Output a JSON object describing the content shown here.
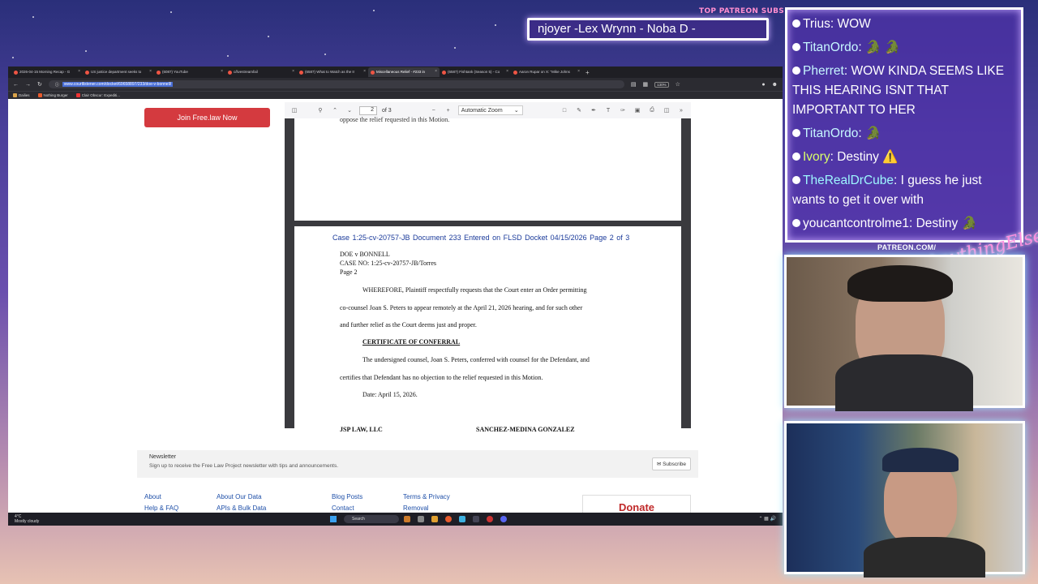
{
  "overlay": {
    "patreon_subs_label": "TOP PATREON SUBS",
    "ticker_text": "njoyer -Lex Wrynn -  Noba D -",
    "patreon_url": "PATREON.COM/",
    "brand_script": "AnythingElse?"
  },
  "browser": {
    "tabs": [
      {
        "label": "2026-04-15 Morning Recap - G",
        "active": false
      },
      {
        "label": "US justice department seeks to",
        "active": false
      },
      {
        "label": "(6087) YouTube",
        "active": false
      },
      {
        "label": "c/livestreamfail",
        "active": false
      },
      {
        "label": "(6587) What to Watch as the Ir",
        "active": false
      },
      {
        "label": "Miscellaneous Relief - #233 in",
        "active": true
      },
      {
        "label": "(6587) Fishtank (Season 5) - Co",
        "active": false
      },
      {
        "label": "Aaron Rupar on X: \"Mike Johns",
        "active": false
      }
    ],
    "new_tab": "+",
    "url": "www.courtlistener.com/docket/69658897/233/doe-v-bonnell/",
    "zoom_badge": "130%",
    "bookmarks": [
      "Dailies",
      "Nothing Burger",
      "Clair Obscur: Expediti..."
    ]
  },
  "page": {
    "join_button": "Join Free.law Now",
    "pdf": {
      "page_number": "2",
      "page_total": "of 3",
      "zoom": "Automatic Zoom",
      "page1_cut_text": "oppose the relief requested in this Motion.",
      "header": "Case 1:25-cv-20757-JB   Document 233   Entered on FLSD Docket 04/15/2026   Page 2 of 3",
      "caption_lines": [
        "DOE v BONNELL",
        "CASE NO: 1:25-cv-20757-JB/Torres",
        "Page 2"
      ],
      "body_lines": [
        "WHEREFORE, Plaintiff respectfully requests that the Court enter an Order permitting",
        "co-counsel Joan S. Peters to appear remotely at the April 21, 2026 hearing, and for such other",
        "and further relief as the Court deems just and proper."
      ],
      "conferral_heading": "CERTIFICATE OF CONFERRAL",
      "conferral_lines": [
        "The undersigned counsel, Joan S. Peters, conferred with counsel for the Defendant, and",
        "certifies that Defendant has no objection to the relief requested in this Motion."
      ],
      "date_line": "Date: April 15, 2026.",
      "sig_left": "JSP LAW, LLC",
      "sig_right": "SANCHEZ-MEDINA GONZALEZ"
    },
    "newsletter": {
      "title": "Newsletter",
      "description": "Sign up to receive the Free Law Project newsletter with tips and announcements.",
      "subscribe": "Subscribe"
    },
    "footer": {
      "about": "About",
      "help": "Help & FAQ",
      "about_data": "About Our Data",
      "apis": "APIs & Bulk Data",
      "blog": "Blog Posts",
      "contact": "Contact",
      "terms": "Terms & Privacy",
      "removal": "Removal",
      "donate": "Donate"
    }
  },
  "taskbar": {
    "weather_temp": "4°C",
    "weather_desc": "Mostly cloudy",
    "search": "Search"
  },
  "chat": [
    {
      "user": "Trius",
      "text": ": WOW",
      "color": "#ffffff"
    },
    {
      "user": "TitanOrdo",
      "text": ": 🐊 🐊",
      "color": "#c6f7ff"
    },
    {
      "user": "Pherret",
      "text": ": WOW KINDA SEEMS LIKE THIS HEARING ISNT THAT IMPORTANT TO HER",
      "color": "#c6f7ff"
    },
    {
      "user": "TitanOrdo",
      "text": ": 🐊",
      "color": "#c6f7ff"
    },
    {
      "user": "Ivory",
      "text": ": Destiny ⚠️",
      "color": "#d8ff6a"
    },
    {
      "user": "TheRealDrCube",
      "text": ": I guess he just wants to get it over with",
      "color": "#9ef7ff"
    },
    {
      "user": "youcantcontrolme1",
      "text": ": Destiny 🐊",
      "color": "#ffffff"
    }
  ]
}
